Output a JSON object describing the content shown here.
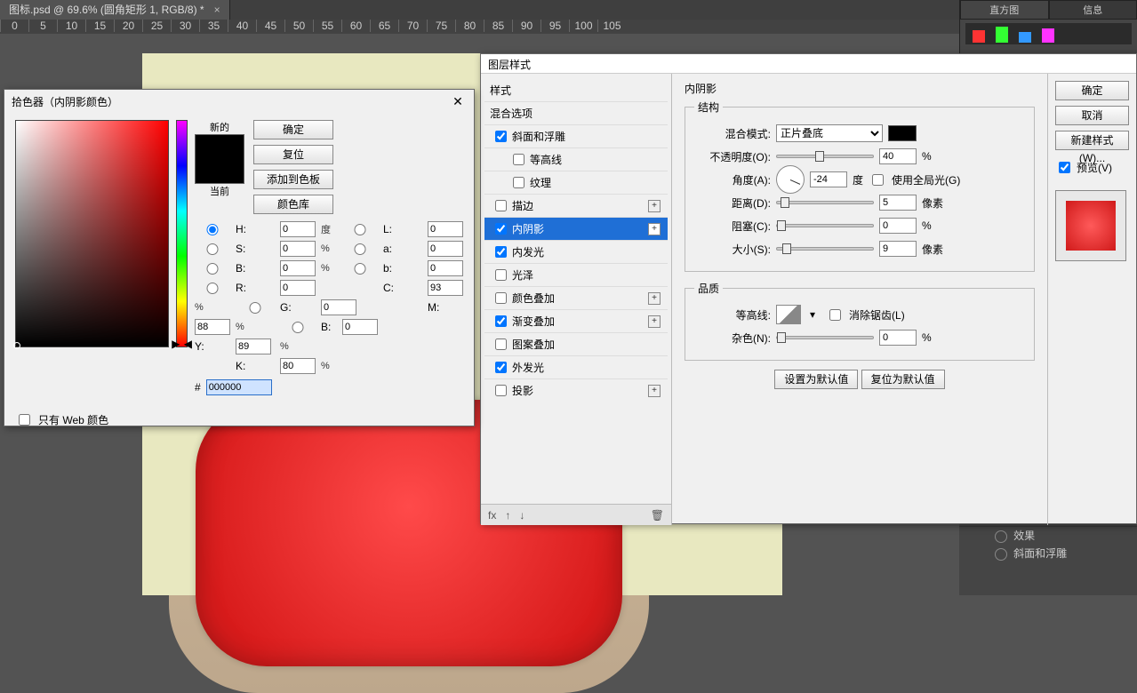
{
  "app": {
    "doc_tab": "图标.psd @ 69.6% (圆角矩形 1, RGB/8) *",
    "ruler_ticks": [
      "0",
      "5",
      "10",
      "15",
      "20",
      "25",
      "30",
      "35",
      "40",
      "45",
      "50",
      "55",
      "60",
      "65",
      "70",
      "75",
      "80",
      "85",
      "90",
      "95",
      "100",
      "105"
    ],
    "right_tabs": {
      "histogram": "直方图",
      "info": "信息"
    }
  },
  "layers_panel": {
    "layer_name": "圆角矩形 1",
    "fx_label": "效果",
    "fx_bevel": "斜面和浮雕"
  },
  "layer_style": {
    "title": "图层样式",
    "styles_header": "样式",
    "blend_options": "混合选项",
    "items": [
      {
        "key": "bevel",
        "label": "斜面和浮雕",
        "checked": true,
        "plus": false
      },
      {
        "key": "contour",
        "label": "等高线",
        "checked": false,
        "plus": false,
        "sub": true
      },
      {
        "key": "texture",
        "label": "纹理",
        "checked": false,
        "plus": false,
        "sub": true
      },
      {
        "key": "stroke",
        "label": "描边",
        "checked": false,
        "plus": true
      },
      {
        "key": "inner_shadow",
        "label": "内阴影",
        "checked": true,
        "plus": true,
        "selected": true
      },
      {
        "key": "inner_glow",
        "label": "内发光",
        "checked": true,
        "plus": false
      },
      {
        "key": "satin",
        "label": "光泽",
        "checked": false,
        "plus": false
      },
      {
        "key": "color_overlay",
        "label": "颜色叠加",
        "checked": false,
        "plus": true
      },
      {
        "key": "gradient_overlay",
        "label": "渐变叠加",
        "checked": true,
        "plus": true
      },
      {
        "key": "pattern_overlay",
        "label": "图案叠加",
        "checked": false,
        "plus": false
      },
      {
        "key": "outer_glow",
        "label": "外发光",
        "checked": true,
        "plus": false
      },
      {
        "key": "drop_shadow",
        "label": "投影",
        "checked": false,
        "plus": true
      }
    ],
    "buttons": {
      "ok": "确定",
      "cancel": "取消",
      "new_style": "新建样式(W)...",
      "preview": "预览(V)",
      "make_default": "设置为默认值",
      "reset_default": "复位为默认值"
    },
    "panel": {
      "title": "内阴影",
      "structure": "结构",
      "blend_mode_label": "混合模式:",
      "blend_mode_value": "正片叠底",
      "opacity_label": "不透明度(O):",
      "opacity_value": "40",
      "opacity_unit": "%",
      "angle_label": "角度(A):",
      "angle_value": "-24",
      "angle_unit": "度",
      "global_light": "使用全局光(G)",
      "distance_label": "距离(D):",
      "distance_value": "5",
      "distance_unit": "像素",
      "choke_label": "阻塞(C):",
      "choke_value": "0",
      "choke_unit": "%",
      "size_label": "大小(S):",
      "size_value": "9",
      "size_unit": "像素",
      "quality": "品质",
      "contour_label": "等高线:",
      "antialias": "消除锯齿(L)",
      "noise_label": "杂色(N):",
      "noise_value": "0",
      "noise_unit": "%"
    },
    "footer": {
      "fx": "fx"
    }
  },
  "color_picker": {
    "title": "拾色器（内阴影颜色）",
    "new_label": "新的",
    "current_label": "当前",
    "buttons": {
      "ok": "确定",
      "cancel": "复位",
      "add": "添加到色板",
      "libraries": "颜色库"
    },
    "web_only": "只有 Web 颜色",
    "hex_label": "#",
    "hex_value": "000000",
    "fields": {
      "H": {
        "label": "H:",
        "value": "0",
        "unit": "度"
      },
      "S": {
        "label": "S:",
        "value": "0",
        "unit": "%"
      },
      "B": {
        "label": "B:",
        "value": "0",
        "unit": "%"
      },
      "R": {
        "label": "R:",
        "value": "0"
      },
      "G": {
        "label": "G:",
        "value": "0"
      },
      "Bc": {
        "label": "B:",
        "value": "0"
      },
      "L": {
        "label": "L:",
        "value": "0"
      },
      "a": {
        "label": "a:",
        "value": "0"
      },
      "b": {
        "label": "b:",
        "value": "0"
      },
      "C": {
        "label": "C:",
        "value": "93",
        "unit": "%"
      },
      "M": {
        "label": "M:",
        "value": "88",
        "unit": "%"
      },
      "Y": {
        "label": "Y:",
        "value": "89",
        "unit": "%"
      },
      "K": {
        "label": "K:",
        "value": "80",
        "unit": "%"
      }
    }
  }
}
